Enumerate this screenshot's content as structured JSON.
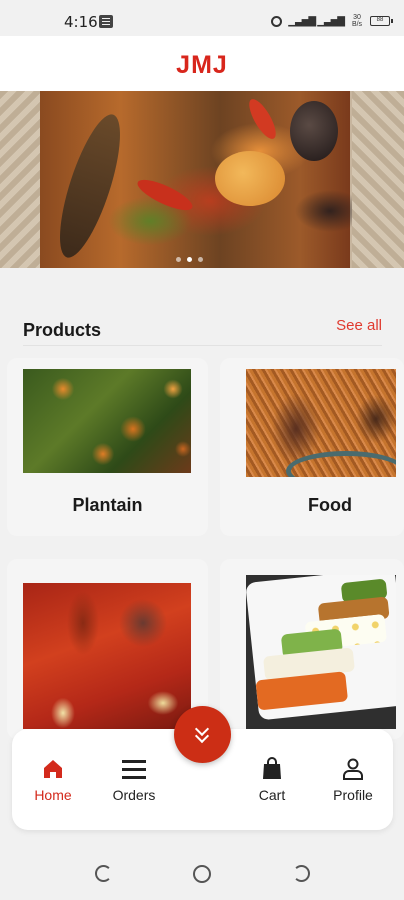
{
  "status_bar": {
    "time": "4:16",
    "network_speed": "30 B/s",
    "battery": "88"
  },
  "header": {
    "title": "JMJ"
  },
  "banner": {
    "image": "food-platter-image",
    "slide_count": 3,
    "active_slide": 1
  },
  "products_section": {
    "title": "Products",
    "see_all": "See all"
  },
  "products": [
    {
      "name": "Plantain",
      "image": "plantain-dish-image"
    },
    {
      "name": "Food",
      "image": "jollof-rice-image"
    },
    {
      "name": "",
      "image": "pepper-soup-image"
    },
    {
      "name": "",
      "image": "salad-tray-image"
    }
  ],
  "fab": {
    "icon": "double-chevron-down-icon"
  },
  "bottom_nav": {
    "items": [
      {
        "label": "Home",
        "icon": "home-icon",
        "active": true
      },
      {
        "label": "Orders",
        "icon": "menu-icon",
        "active": false
      },
      {
        "label": "Cart",
        "icon": "shopping-bag-icon",
        "active": false
      },
      {
        "label": "Profile",
        "icon": "person-icon",
        "active": false
      }
    ]
  },
  "colors": {
    "accent": "#d8261c",
    "see_all": "#e0392e",
    "fab": "#cc2e15",
    "background": "#f1f1f1"
  }
}
